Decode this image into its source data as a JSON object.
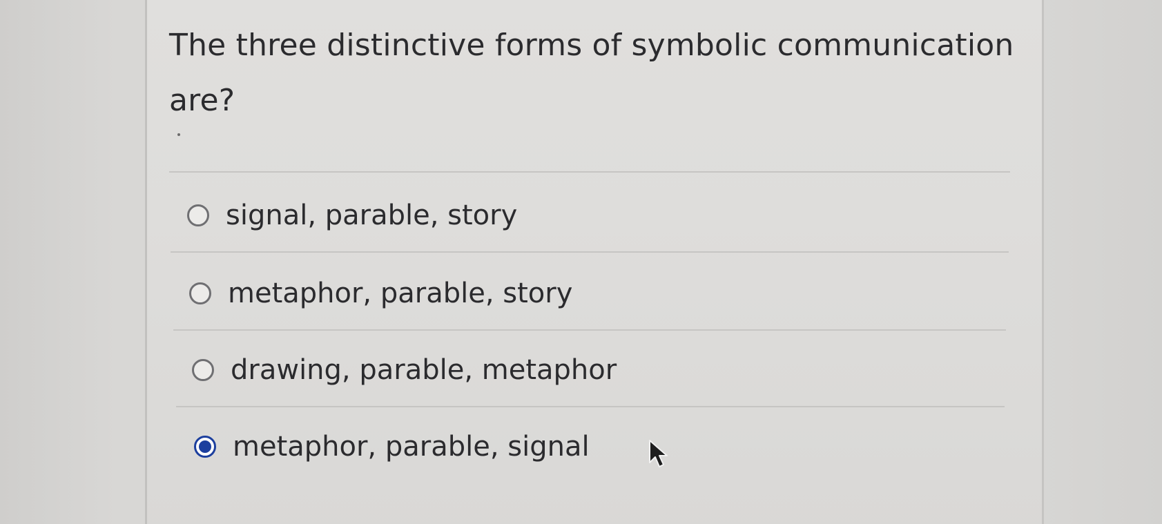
{
  "question": {
    "text": "The three distinctive forms of symbolic communication are?"
  },
  "options": [
    {
      "label": "signal, parable, story",
      "selected": false
    },
    {
      "label": "metaphor, parable, story",
      "selected": false
    },
    {
      "label": "drawing, parable, metaphor",
      "selected": false
    },
    {
      "label": "metaphor, parable, signal",
      "selected": true
    }
  ],
  "colors": {
    "selected_radio": "#1c3f9e",
    "text": "#2b2b2e",
    "card_background": "#dedddb"
  },
  "icons": {
    "cursor": "mouse-pointer-arrow-icon"
  }
}
